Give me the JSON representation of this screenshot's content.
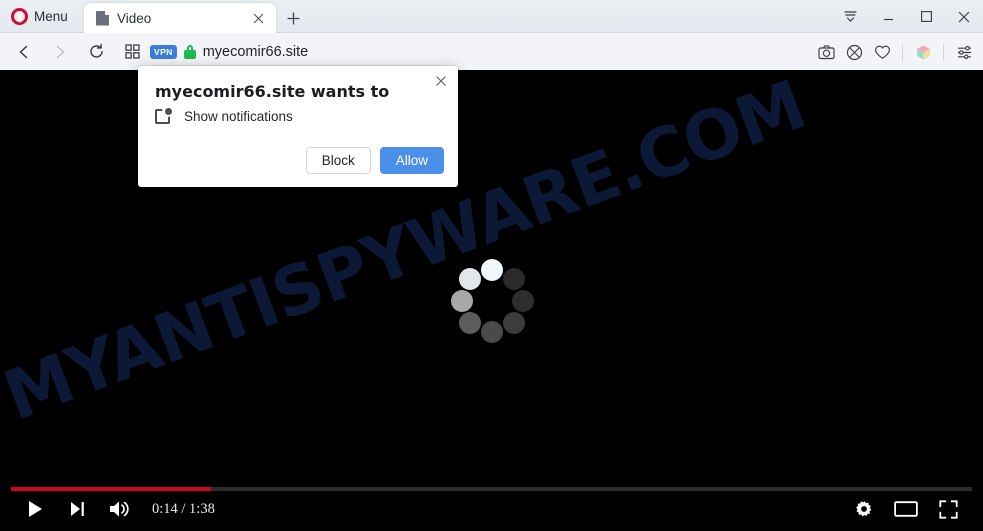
{
  "browser": {
    "name": "Opera",
    "menu_label": "Menu",
    "menu_icon": "opera-logo-icon",
    "tabs": [
      {
        "title": "Video",
        "favicon": "page-document-icon",
        "close_icon": "close-icon",
        "active": true
      }
    ],
    "new_tab_icon": "plus-icon",
    "window_controls": [
      {
        "name": "tab-list",
        "icon": "tab-list-chevron-icon"
      },
      {
        "name": "minimize",
        "icon": "minimize-icon"
      },
      {
        "name": "maximize",
        "icon": "maximize-square-icon"
      },
      {
        "name": "close",
        "icon": "close-x-icon"
      }
    ],
    "navigation": [
      {
        "name": "back",
        "icon": "chevron-left-icon",
        "enabled": true
      },
      {
        "name": "forward",
        "icon": "chevron-right-icon",
        "enabled": false
      },
      {
        "name": "reload",
        "icon": "reload-circular-arrow-icon",
        "enabled": true
      },
      {
        "name": "speed-dial",
        "icon": "grid-four-squares-icon",
        "enabled": true
      }
    ],
    "address_bar": {
      "vpn_badge": "VPN",
      "security_icon": "green-padlock-icon",
      "url": "myecomir66.site"
    },
    "toolbar_right": [
      {
        "name": "snapshot",
        "icon": "camera-icon"
      },
      {
        "name": "ad-blocker",
        "icon": "shield-blocked-icon"
      },
      {
        "name": "favorites",
        "icon": "heart-icon"
      },
      {
        "name": "extension",
        "icon": "colored-cube-icon"
      },
      {
        "name": "easy-setup",
        "icon": "sliders-settings-icon"
      }
    ]
  },
  "dialog": {
    "title": "myecomir66.site wants to",
    "permission_icon": "notification-bell-badge-icon",
    "permission_label": "Show notifications",
    "close_icon": "close-icon",
    "block_label": "Block",
    "allow_label": "Allow",
    "allow_color": "#4a90e8"
  },
  "page": {
    "watermark": "MYANTISPYWARE.COM",
    "watermark_color": "#0d1c3c",
    "background_color": "#000000",
    "loading_spinner": "circular-dots-spinner-icon"
  },
  "player": {
    "progress_percent": "20.8",
    "progress_color": "#cc0a17",
    "current_time": "0:14",
    "duration": "1:38",
    "time_display": "0:14 / 1:38",
    "controls_left": [
      {
        "name": "play",
        "icon": "play-triangle-icon"
      },
      {
        "name": "next-video",
        "icon": "next-track-icon"
      },
      {
        "name": "volume",
        "icon": "speaker-volume-icon"
      }
    ],
    "controls_right": [
      {
        "name": "settings",
        "icon": "gear-icon"
      },
      {
        "name": "miniplayer",
        "icon": "miniplayer-rectangle-icon"
      },
      {
        "name": "fullscreen",
        "icon": "fullscreen-corners-icon"
      }
    ]
  }
}
